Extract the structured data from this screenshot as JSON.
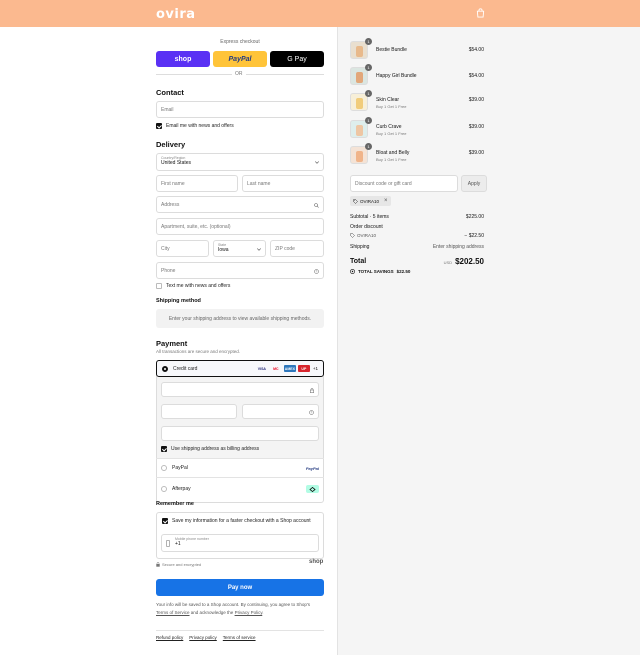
{
  "header": {
    "logo": "ovira",
    "bag_icon": "bag-icon"
  },
  "express": {
    "label": "Express checkout",
    "shop": "shop",
    "paypal": "PayPal",
    "gpay": "G Pay",
    "or": "OR"
  },
  "contact": {
    "title": "Contact",
    "email_placeholder": "Email",
    "newsletter_label": "Email me with news and offers"
  },
  "delivery": {
    "title": "Delivery",
    "country_label": "Country/Region",
    "country_value": "United States",
    "first_name": "First name",
    "last_name": "Last name",
    "address": "Address",
    "apartment": "Apartment, suite, etc. (optional)",
    "city": "City",
    "state_label": "State",
    "state_value": "Iowa",
    "zip": "ZIP code",
    "phone": "Phone",
    "sms_label": "Text me with news and offers"
  },
  "shipping": {
    "title": "Shipping method",
    "info": "Enter your shipping address to view available shipping methods."
  },
  "payment": {
    "title": "Payment",
    "subtitle": "All transactions are secure and encrypted.",
    "credit_card": "Credit card",
    "card_logos": [
      "VISA",
      "MC",
      "AMEX",
      "UP"
    ],
    "more_cards": "+1",
    "billing_label": "Use shipping address as billing address",
    "paypal": "PayPal",
    "paypal_logo": "PayPal",
    "afterpay": "Afterpay"
  },
  "remember": {
    "title": "Remember me",
    "save_label": "Save my information for a faster checkout with a Shop account",
    "mobile_label": "Mobile phone number",
    "mobile_value": "+1",
    "secure_label": "Secure and encrypted",
    "shop_logo": "shop"
  },
  "pay_now": "Pay now",
  "legal": {
    "text_1": "Your info will be saved to a Shop account. By continuing, you agree to Shop's",
    "tos": "Terms of Service",
    "text_2": " and acknowledge the ",
    "privacy": "Privacy Policy",
    "text_3": "."
  },
  "footer": {
    "refund": "Refund policy",
    "privacy": "Privacy policy",
    "terms": "Terms of service"
  },
  "cart": {
    "items": [
      {
        "name": "Bestie Bundle",
        "sub": "",
        "qty": "1",
        "price": "$54.00"
      },
      {
        "name": "Happy Girl Bundle",
        "sub": "",
        "qty": "1",
        "price": "$54.00"
      },
      {
        "name": "Skin Clear",
        "sub": "Buy 1 Get 1 Free",
        "qty": "1",
        "price": "$39.00"
      },
      {
        "name": "Curb Crave",
        "sub": "Buy 1 Get 1 Free",
        "qty": "1",
        "price": "$39.00"
      },
      {
        "name": "Bloat and Belly",
        "sub": "Buy 1 Get 1 Free",
        "qty": "1",
        "price": "$39.00"
      }
    ],
    "discount_placeholder": "Discount code or gift card",
    "apply": "Apply",
    "applied_code": "OVIRA10",
    "subtotal_label": "Subtotal · 5 items",
    "subtotal_value": "$225.00",
    "order_discount_label": "Order discount",
    "order_discount_code": "OVIRA10",
    "order_discount_value": "− $22.50",
    "shipping_label": "Shipping",
    "shipping_value": "Enter shipping address",
    "total_label": "Total",
    "currency": "USD",
    "total_value": "$202.50",
    "savings_label": "TOTAL SAVINGS",
    "savings_value": "$22.50"
  }
}
